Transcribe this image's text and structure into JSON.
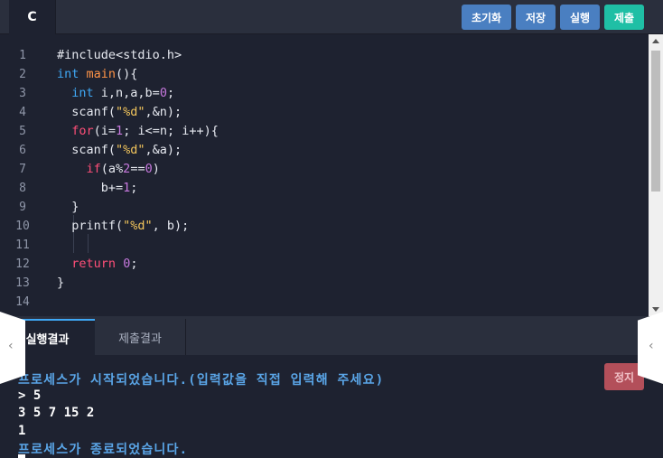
{
  "header": {
    "language_tab": "C",
    "buttons": {
      "reset": "초기화",
      "save": "저장",
      "run": "실행",
      "submit": "제출"
    }
  },
  "editor": {
    "line_numbers": [
      "1",
      "2",
      "3",
      "4",
      "5",
      "6",
      "7",
      "8",
      "9",
      "10",
      "11",
      "12",
      "13",
      "14"
    ],
    "lines": [
      "#include<stdio.h>",
      "int main(){",
      "  int i,n,a,b=0;",
      "  scanf(\"%d\",&n);",
      "  for(i=1; i<=n; i++){",
      "  scanf(\"%d\",&a);",
      "    if(a%2==0)",
      "      b+=1;",
      "  }",
      "  printf(\"%d\", b);",
      "",
      "  return 0;",
      "}",
      ""
    ]
  },
  "output_tabs": {
    "run_result": "실행결과",
    "submit_result": "제출결과"
  },
  "console": {
    "lines": [
      {
        "type": "system",
        "text": "프로세스가 시작되었습니다.(입력값을 직접 입력해 주세요)"
      },
      {
        "type": "user",
        "text": "> 5"
      },
      {
        "type": "user",
        "text": "3 5 7 15 2"
      },
      {
        "type": "user",
        "text": "1"
      },
      {
        "type": "system",
        "text": "프로세스가 종료되었습니다."
      }
    ],
    "stop_label": "정지"
  },
  "colors": {
    "accent_blue": "#4a7fc1",
    "accent_teal": "#1fbfa5",
    "stop_red": "#b34f5a",
    "background": "#1e2230"
  }
}
